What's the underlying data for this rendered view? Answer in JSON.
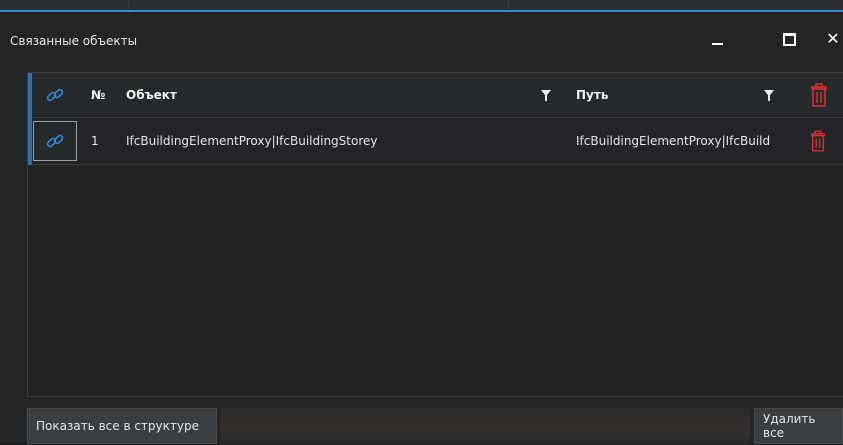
{
  "window": {
    "title": "Связанные объекты"
  },
  "table": {
    "columns": {
      "number": "№",
      "object": "Объект",
      "path": "Путь"
    },
    "rows": [
      {
        "number": "1",
        "object": "IfcBuildingElementProxy|IfcBuildingStorey",
        "path": "IfcBuildingElementProxy|IfcBuild"
      }
    ]
  },
  "footer": {
    "show_all_label": "Показать все в структуре",
    "delete_all_label": "Удалить все"
  },
  "colors": {
    "accent": "#2f6fb4",
    "link_icon": "#3a86d6",
    "delete_icon": "#d32f2f"
  },
  "icons": {
    "link": "link-icon",
    "filter": "filter-icon",
    "trash": "trash-icon",
    "minimize": "minimize-icon",
    "maximize": "maximize-icon",
    "close": "close-icon"
  }
}
